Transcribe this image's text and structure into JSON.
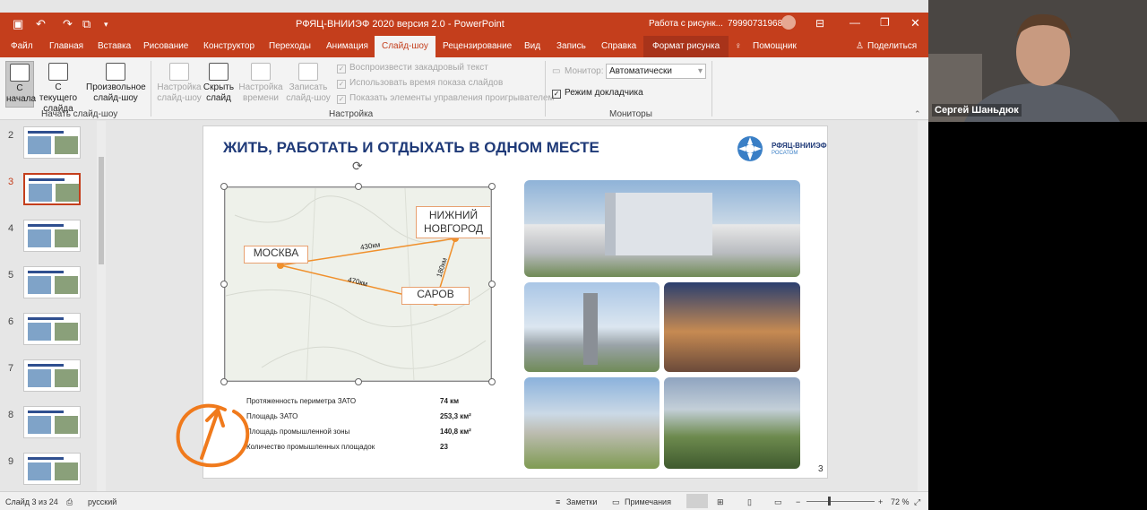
{
  "window": {
    "title": "РФЯЦ-ВНИИЭФ 2020 версия 2.0  -  PowerPoint",
    "context_label": "Работа с рисунк...",
    "phone": "79990731968"
  },
  "tabs": [
    "Файл",
    "Главная",
    "Вставка",
    "Рисование",
    "Конструктор",
    "Переходы",
    "Анимация",
    "Слайд-шоу",
    "Рецензирование",
    "Вид",
    "Запись",
    "Справка",
    "Формат рисунка",
    "Помощник",
    "Поделиться"
  ],
  "ribbon": {
    "start_group": {
      "from_beginning": "С начала",
      "from_current": "С текущего слайда",
      "custom": "Произвольное слайд-шоу",
      "label": "Начать слайд-шоу"
    },
    "setup_group": {
      "setup_show": "Настройка слайд-шоу",
      "hide_slide": "Скрыть слайд",
      "rehearse": "Настройка времени",
      "record": "Записать слайд-шоу",
      "cb_narration": "Воспроизвести закадровый текст",
      "cb_timings": "Использовать время показа слайдов",
      "cb_controls": "Показать элементы управления проигрывателем",
      "label": "Настройка"
    },
    "monitors_group": {
      "monitor_label": "Монитор:",
      "monitor_value": "Автоматически",
      "presenter_view": "Режим докладчика",
      "label": "Мониторы"
    }
  },
  "slide_numbers": [
    "2",
    "3",
    "4",
    "5",
    "6",
    "7",
    "8",
    "9"
  ],
  "slide": {
    "title": "ЖИТЬ, РАБОТАТЬ И ОТДЫХАТЬ В ОДНОМ МЕСТЕ",
    "logo_text1": "РФЯЦ-ВНИИЭФ",
    "logo_text2": "РОСАТОМ",
    "cities": {
      "moscow": "МОСКВА",
      "nn_line1": "НИЖНИЙ",
      "nn_line2": "НОВГОРОД",
      "sarov": "САРОВ"
    },
    "distances": {
      "msk_nn": "430км",
      "msk_sarov": "470км",
      "nn_sarov": "180км"
    },
    "stats": [
      {
        "label": "Протяженность периметра ЗАТО",
        "value": "74 км"
      },
      {
        "label": "Площадь ЗАТО",
        "value": "253,3 км²"
      },
      {
        "label": "Площадь промышленной зоны",
        "value": "140,8 км²"
      },
      {
        "label": "Количество промышленных площадок",
        "value": "23"
      }
    ],
    "page_number": "3"
  },
  "status": {
    "slide_of": "Слайд 3 из 24",
    "language": "русский",
    "notes": "Заметки",
    "comments": "Примечания",
    "zoom": "72 %"
  },
  "video": {
    "name": "Сергей Шаньдюк"
  },
  "colors": {
    "accent": "#c43e1c",
    "title": "#1f3a78",
    "annotation": "#f07a1c"
  }
}
